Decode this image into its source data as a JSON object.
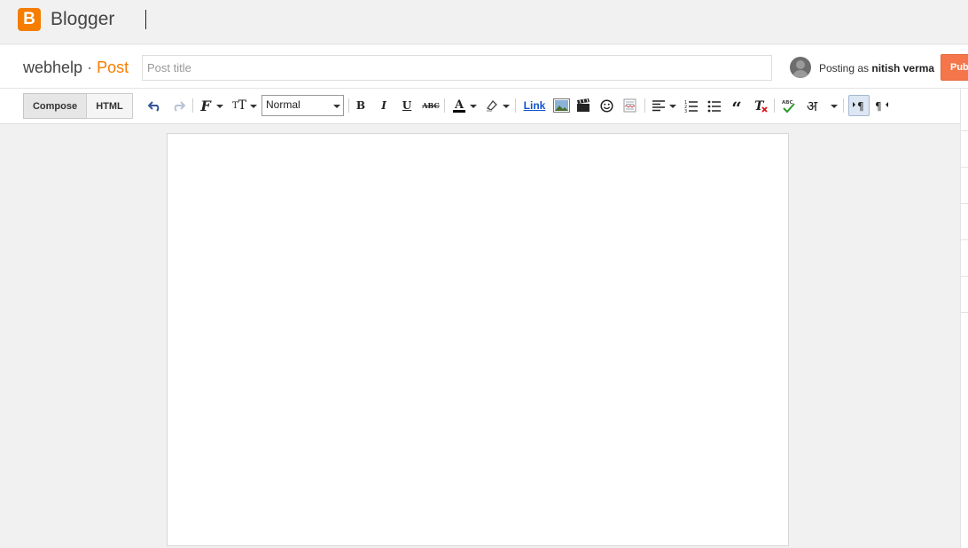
{
  "app": {
    "brand": "Blogger",
    "logo_letter": "B",
    "logo_color": "#f57d00"
  },
  "post_header": {
    "blog_name": "webhelp",
    "separator": "·",
    "section": "Post",
    "title_placeholder": "Post title",
    "title_value": "",
    "posting_as_prefix": "Posting as",
    "user_name": "nitish verma",
    "publish_label": "Publish"
  },
  "toolbar": {
    "compose_label": "Compose",
    "html_label": "HTML",
    "active_mode": "Compose",
    "paragraph_format": "Normal",
    "link_label": "Link",
    "hindi_char": "अ",
    "icons": [
      "undo-icon",
      "redo-icon",
      "font-family-icon",
      "font-size-icon",
      "bold-icon",
      "italic-icon",
      "underline-icon",
      "strikethrough-icon",
      "text-color-icon",
      "highlight-icon",
      "image-icon",
      "video-icon",
      "emoji-icon",
      "jump-break-icon",
      "align-icon",
      "numbered-list-icon",
      "bullet-list-icon",
      "quote-icon",
      "clear-formatting-icon",
      "spellcheck-icon",
      "transliterate-icon",
      "ltr-icon",
      "rtl-icon"
    ],
    "accent_color": "#1155cc"
  },
  "editor": {
    "content": ""
  }
}
